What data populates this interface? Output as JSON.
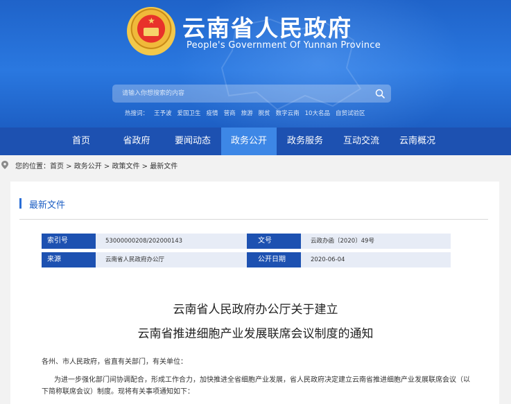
{
  "header": {
    "title_cn": "云南省人民政府",
    "title_en": "People's Government Of Yunnan Province",
    "search_placeholder": "请输入你想搜索的内容",
    "hot_label": "热搜词：",
    "hot_words": [
      "王予波",
      "爱国卫生",
      "疫情",
      "营商",
      "旅游",
      "脱贫",
      "数字云南",
      "10大名品",
      "自贸试验区"
    ]
  },
  "nav": {
    "items": [
      {
        "label": "首页"
      },
      {
        "label": "省政府"
      },
      {
        "label": "要闻动态"
      },
      {
        "label": "政务公开",
        "active": true
      },
      {
        "label": "政务服务"
      },
      {
        "label": "互动交流"
      },
      {
        "label": "云南概况"
      }
    ]
  },
  "breadcrumb": {
    "text": "您的位置：首页 > 政务公开 > 政策文件 > 最新文件"
  },
  "column": {
    "title": "最新文件"
  },
  "meta": {
    "index_label": "索引号",
    "index_value": "53000000208/202000143",
    "docno_label": "文号",
    "docno_value": "云政办函〔2020〕49号",
    "source_label": "来源",
    "source_value": "云南省人民政府办公厅",
    "date_label": "公开日期",
    "date_value": "2020-06-04"
  },
  "document": {
    "title_line1": "云南省人民政府办公厅关于建立",
    "title_line2": "云南省推进细胞产业发展联席会议制度的通知",
    "salutation": "各州、市人民政府，省直有关部门，有关单位：",
    "body_line1": "为进一步强化部门间协调配合，形成工作合力，加快推进全省细胞产业发展，省人民政府决定建立云南省推进细胞产业发展联席会议（以",
    "body_line2": "下简称联席会议）制度。现将有关事项通知如下："
  },
  "colors": {
    "header_blue": "#2a78e0",
    "nav_blue": "#1d51b1",
    "nav_active": "#3d87e6",
    "meta_value_bg": "#e7ecf6"
  }
}
